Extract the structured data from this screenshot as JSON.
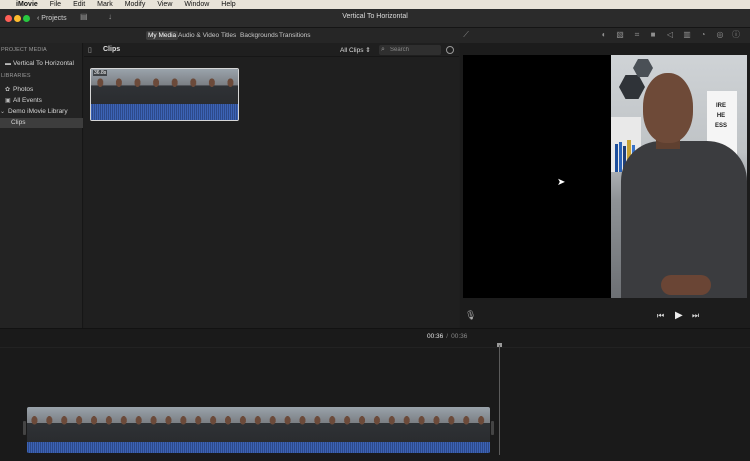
{
  "menubar": {
    "apple": "",
    "app": "iMovie",
    "items": [
      "File",
      "Edit",
      "Mark",
      "Modify",
      "View",
      "Window",
      "Help"
    ]
  },
  "titlebar": {
    "projects_label": "Projects",
    "title": "Vertical To Horizontal"
  },
  "toolbar": {
    "tabs": [
      "My Media",
      "Audio & Video",
      "Titles",
      "Backgrounds",
      "Transitions"
    ],
    "active_tab": "My Media"
  },
  "sidebar": {
    "project_media_header": "PROJECT MEDIA",
    "project_name": "Vertical To Horizontal",
    "libraries_header": "LIBRARIES",
    "photos": "Photos",
    "all_events": "All Events",
    "library": "Demo iMovie Library",
    "clips": "Clips"
  },
  "browser": {
    "title": "Clips",
    "filter": "All Clips",
    "search_placeholder": "Search",
    "clip_duration": "36.8s"
  },
  "viewer": {
    "book_lines": [
      "IRE",
      "HE",
      "ESS"
    ]
  },
  "timeline": {
    "current_time": "00:36",
    "separator": "/",
    "total_time": "00:36"
  },
  "colors": {
    "accent_tab": "#3e3e3e",
    "audio_wave": "#2d4a8a",
    "traffic_red": "#ff5f57",
    "traffic_yellow": "#febc2e",
    "traffic_green": "#28c840"
  }
}
